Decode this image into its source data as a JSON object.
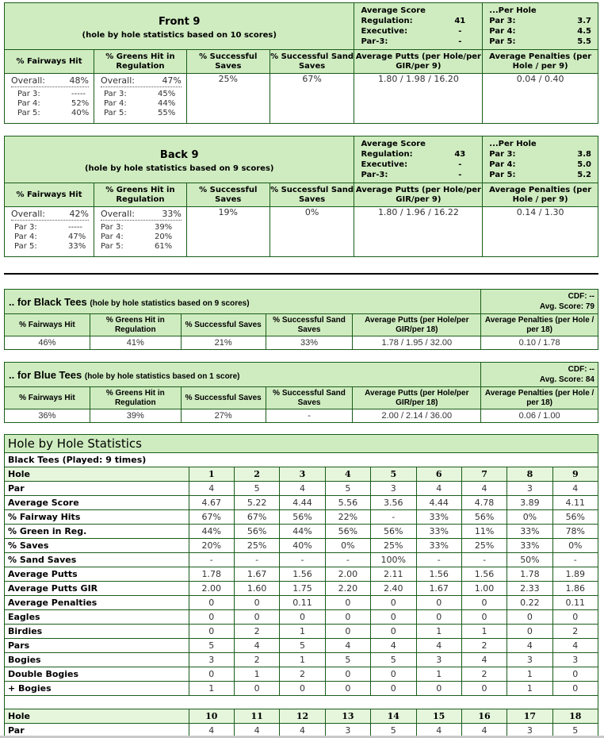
{
  "front9": {
    "title": "Front 9",
    "subtitle": "(hole by hole statistics based on 10 scores)",
    "avg_score": {
      "heading": "Average Score",
      "rows": [
        {
          "label": "Regulation:",
          "value": "41"
        },
        {
          "label": "Executive:",
          "value": "-"
        },
        {
          "label": "Par-3:",
          "value": "-"
        }
      ]
    },
    "per_hole": {
      "heading": "...Per Hole",
      "rows": [
        {
          "label": "Par 3:",
          "value": "3.7"
        },
        {
          "label": "Par 4:",
          "value": "4.5"
        },
        {
          "label": "Par 5:",
          "value": "5.5"
        }
      ]
    },
    "col_headers": [
      "% Fairways Hit",
      "% Greens Hit in Regulation",
      "% Successful Saves",
      "% Successful Sand Saves",
      "Average Putts (per Hole/per GIR/per 9)",
      "Average Penalties (per Hole / per 9)"
    ],
    "fairways": {
      "overall_label": "Overall:",
      "overall": "48%",
      "par3": "-----",
      "par4": "52%",
      "par5": "40%"
    },
    "greens": {
      "overall_label": "Overall:",
      "overall": "47%",
      "par3": "45%",
      "par4": "44%",
      "par5": "55%"
    },
    "saves": "25%",
    "sand_saves": "67%",
    "putts": "1.80 / 1.98 / 16.20",
    "penalties": "0.04 / 0.40",
    "par_labels": [
      "Par 3:",
      "Par 4:",
      "Par 5:"
    ]
  },
  "back9": {
    "title": "Back 9",
    "subtitle": "(hole by hole statistics based on 9 scores)",
    "avg_score": {
      "heading": "Average Score",
      "rows": [
        {
          "label": "Regulation:",
          "value": "43"
        },
        {
          "label": "Executive:",
          "value": "-"
        },
        {
          "label": "Par-3:",
          "value": "-"
        }
      ]
    },
    "per_hole": {
      "heading": "...Per Hole",
      "rows": [
        {
          "label": "Par 3:",
          "value": "3.8"
        },
        {
          "label": "Par 4:",
          "value": "5.0"
        },
        {
          "label": "Par 5:",
          "value": "5.2"
        }
      ]
    },
    "col_headers": [
      "% Fairways Hit",
      "% Greens Hit in Regulation",
      "% Successful Saves",
      "% Successful Sand Saves",
      "Average Putts (per Hole/per GIR/per 9)",
      "Average Penalties (per Hole / per 9)"
    ],
    "fairways": {
      "overall_label": "Overall:",
      "overall": "42%",
      "par3": "-----",
      "par4": "47%",
      "par5": "33%"
    },
    "greens": {
      "overall_label": "Overall:",
      "overall": "33%",
      "par3": "39%",
      "par4": "20%",
      "par5": "61%"
    },
    "saves": "19%",
    "sand_saves": "0%",
    "putts": "1.80 / 1.96 / 16.22",
    "penalties": "0.14 / 1.30",
    "par_labels": [
      "Par 3:",
      "Par 4:",
      "Par 5:"
    ]
  },
  "black_tees": {
    "title": ".. for Black Tees",
    "subtitle": "(hole by hole statistics based on 9 scores)",
    "cdf": "CDF: --",
    "avg_score": "Avg. Score: 79",
    "col_headers": [
      "% Fairways Hit",
      "% Greens Hit in Regulation",
      "% Successful Saves",
      "% Successful Sand Saves",
      "Average Putts (per Hole/per GIR/per 18)",
      "Average Penalties (per Hole / per 18)"
    ],
    "values": [
      "46%",
      "41%",
      "21%",
      "33%",
      "1.78 / 1.95 / 32.00",
      "0.10 / 1.78"
    ]
  },
  "blue_tees": {
    "title": ".. for Blue Tees",
    "subtitle": "(hole by hole statistics based on 1 score)",
    "cdf": "CDF: --",
    "avg_score": "Avg. Score: 84",
    "col_headers": [
      "% Fairways Hit",
      "% Greens Hit in Regulation",
      "% Successful Saves",
      "% Successful Sand Saves",
      "Average Putts (per Hole/per GIR/per 18)",
      "Average Penalties (per Hole / per 18)"
    ],
    "values": [
      "36%",
      "39%",
      "27%",
      "-",
      "2.00 / 2.14 / 36.00",
      "0.06 / 1.00"
    ]
  },
  "hole_by_hole": {
    "title": "Hole by Hole Statistics",
    "subtitle": "Black Tees (Played: 9 times)",
    "front": {
      "header": {
        "label": "Hole",
        "values": [
          "1",
          "2",
          "3",
          "4",
          "5",
          "6",
          "7",
          "8",
          "9"
        ]
      },
      "rows": [
        {
          "label": "Par",
          "values": [
            "4",
            "5",
            "4",
            "5",
            "3",
            "4",
            "4",
            "3",
            "4"
          ]
        },
        {
          "label": "Average Score",
          "values": [
            "4.67",
            "5.22",
            "4.44",
            "5.56",
            "3.56",
            "4.44",
            "4.78",
            "3.89",
            "4.11"
          ]
        },
        {
          "label": "% Fairway Hits",
          "values": [
            "67%",
            "67%",
            "56%",
            "22%",
            "-",
            "33%",
            "56%",
            "0%",
            "56%"
          ]
        },
        {
          "label": "% Green in Reg.",
          "values": [
            "44%",
            "56%",
            "44%",
            "56%",
            "56%",
            "33%",
            "11%",
            "33%",
            "78%"
          ]
        },
        {
          "label": "% Saves",
          "values": [
            "20%",
            "25%",
            "40%",
            "0%",
            "25%",
            "33%",
            "25%",
            "33%",
            "0%"
          ]
        },
        {
          "label": "% Sand Saves",
          "values": [
            "-",
            "-",
            "-",
            "-",
            "100%",
            "-",
            "-",
            "50%",
            "-"
          ]
        },
        {
          "label": "Average Putts",
          "values": [
            "1.78",
            "1.67",
            "1.56",
            "2.00",
            "2.11",
            "1.56",
            "1.56",
            "1.78",
            "1.89"
          ]
        },
        {
          "label": "Average Putts GIR",
          "values": [
            "2.00",
            "1.60",
            "1.75",
            "2.20",
            "2.40",
            "1.67",
            "1.00",
            "2.33",
            "1.86"
          ]
        },
        {
          "label": "Average Penalties",
          "values": [
            "0",
            "0",
            "0.11",
            "0",
            "0",
            "0",
            "0",
            "0.22",
            "0.11"
          ]
        },
        {
          "label": "Eagles",
          "values": [
            "0",
            "0",
            "0",
            "0",
            "0",
            "0",
            "0",
            "0",
            "0"
          ]
        },
        {
          "label": "Birdies",
          "values": [
            "0",
            "2",
            "1",
            "0",
            "0",
            "1",
            "1",
            "0",
            "2"
          ]
        },
        {
          "label": "Pars",
          "values": [
            "5",
            "4",
            "5",
            "4",
            "4",
            "4",
            "2",
            "4",
            "4"
          ]
        },
        {
          "label": "Bogies",
          "values": [
            "3",
            "2",
            "1",
            "5",
            "5",
            "3",
            "4",
            "3",
            "3"
          ]
        },
        {
          "label": "Double Bogies",
          "values": [
            "0",
            "1",
            "2",
            "0",
            "0",
            "1",
            "2",
            "1",
            "0"
          ]
        },
        {
          "label": "+ Bogies",
          "values": [
            "1",
            "0",
            "0",
            "0",
            "0",
            "0",
            "0",
            "1",
            "0"
          ]
        }
      ]
    },
    "back": {
      "header": {
        "label": "Hole",
        "values": [
          "10",
          "11",
          "12",
          "13",
          "14",
          "15",
          "16",
          "17",
          "18"
        ]
      },
      "rows": [
        {
          "label": "Par",
          "values": [
            "4",
            "4",
            "4",
            "3",
            "5",
            "4",
            "4",
            "3",
            "5"
          ]
        }
      ]
    }
  },
  "colors": {
    "header_green": "#cfecc0",
    "light_green": "#e6f6dc",
    "border": "#1a5c1a"
  }
}
